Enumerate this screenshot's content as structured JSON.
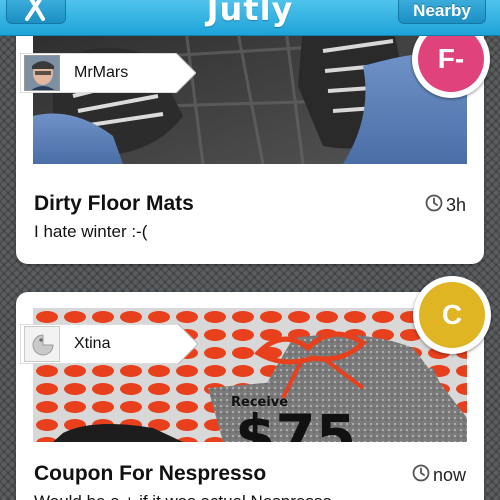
{
  "nav": {
    "title": "Jutly",
    "right_button": "Nearby",
    "left_button_icon": "scissors-icon"
  },
  "colors": {
    "nav_blue": "#2aaee0",
    "badge_f": "#e0427c",
    "badge_c": "#e0b524"
  },
  "posts": [
    {
      "user": "MrMars",
      "title": "Dirty Floor Mats",
      "description": "I hate winter :-(",
      "time": "3h",
      "badge": "F-"
    },
    {
      "user": "Xtina",
      "title": "Coupon For Nespresso",
      "description": "Would be a + if it was actual Nespresso",
      "time": "now",
      "badge": "C",
      "photo_text_1": "Receive",
      "photo_text_2": "$75"
    }
  ]
}
